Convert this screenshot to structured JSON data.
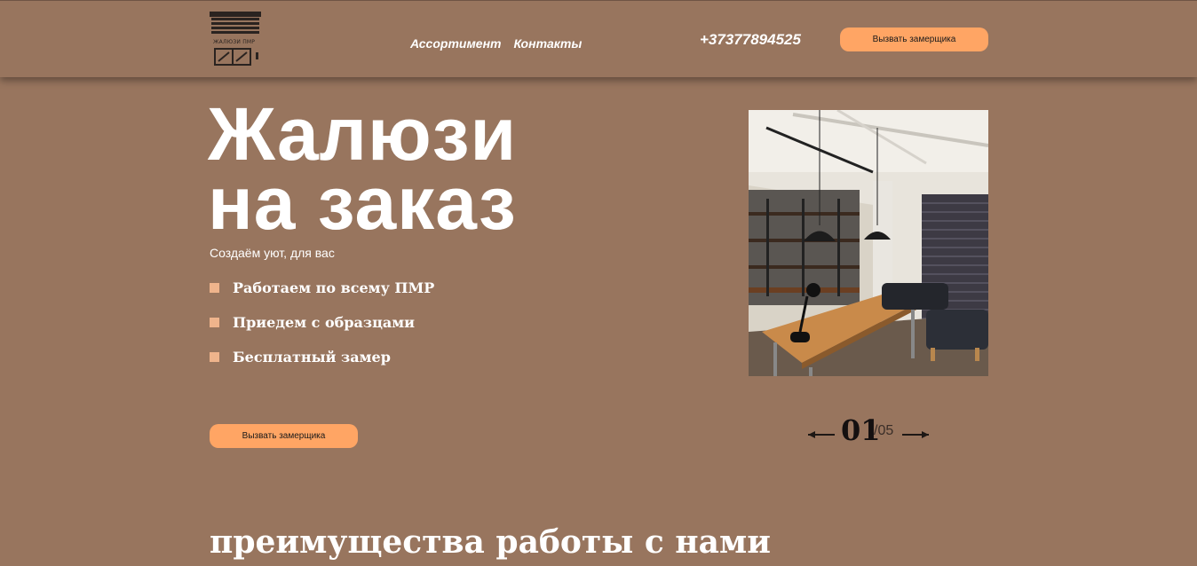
{
  "header": {
    "logo_text": "ЖАЛЮЗИ ПМР",
    "nav": [
      {
        "label": "Ассортимент"
      },
      {
        "label": "Контакты"
      }
    ],
    "phone": "+37377894525",
    "cta_label": "Вызвать замерщика"
  },
  "hero": {
    "title_line1": "Жалюзи",
    "title_line2": "на заказ",
    "subtitle": "Создаём уют, для вас",
    "features": [
      "Работаем по всему ПМР",
      "Приедем с образцами",
      "Бесплатный замер"
    ],
    "cta_label": "Вызвать замерщика"
  },
  "slider": {
    "current": "01",
    "total": "/05"
  },
  "advantages": {
    "title": "преимущества работы с нами"
  },
  "colors": {
    "background": "#98755e",
    "accent": "#ffa564",
    "bullet": "#efb48c"
  }
}
